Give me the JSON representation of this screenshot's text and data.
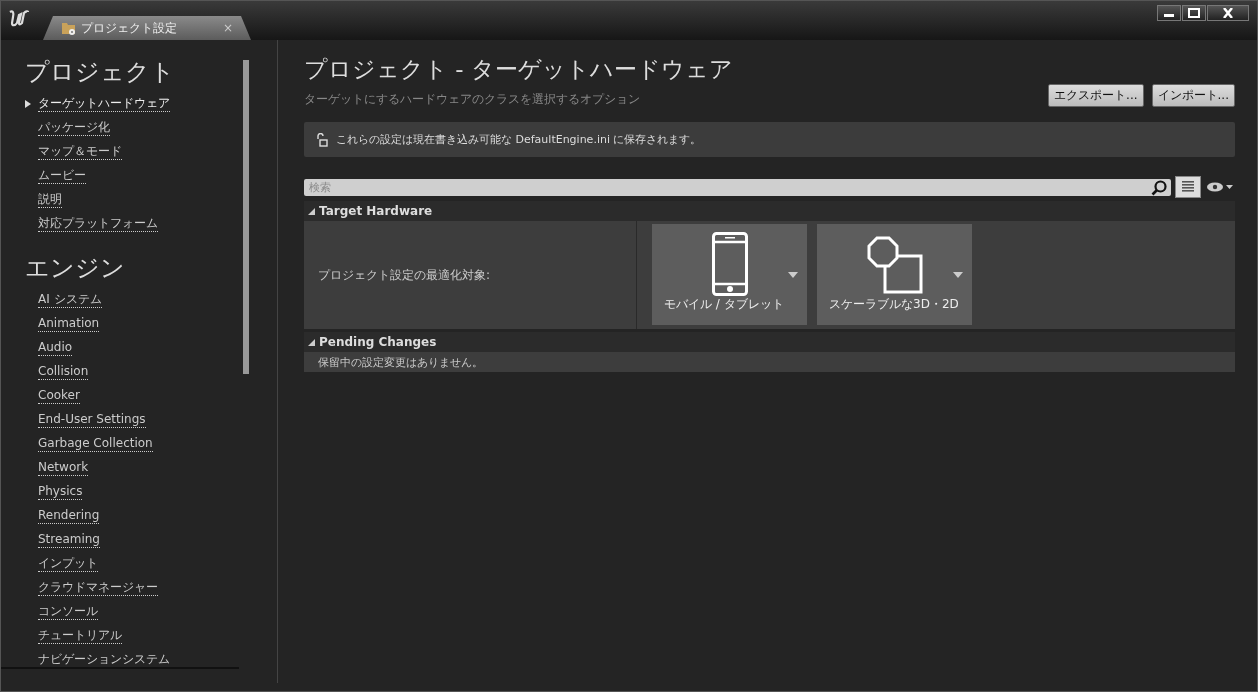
{
  "window": {
    "tab_title": "プロジェクト設定",
    "tab_close": "×"
  },
  "sidebar": {
    "sections": [
      {
        "title": "プロジェクト",
        "items": [
          {
            "label": "ターゲットハードウェア",
            "selected": true
          },
          {
            "label": "パッケージ化",
            "selected": false
          },
          {
            "label": "マップ＆モード",
            "selected": false
          },
          {
            "label": "ムービー",
            "selected": false
          },
          {
            "label": "説明",
            "selected": false
          },
          {
            "label": "対応プラットフォーム",
            "selected": false
          }
        ]
      },
      {
        "title": "エンジン",
        "items": [
          {
            "label": "AI システム",
            "selected": false
          },
          {
            "label": "Animation",
            "selected": false
          },
          {
            "label": "Audio",
            "selected": false
          },
          {
            "label": "Collision",
            "selected": false
          },
          {
            "label": "Cooker",
            "selected": false
          },
          {
            "label": "End-User Settings",
            "selected": false
          },
          {
            "label": "Garbage Collection",
            "selected": false
          },
          {
            "label": "Network",
            "selected": false
          },
          {
            "label": "Physics",
            "selected": false
          },
          {
            "label": "Rendering",
            "selected": false
          },
          {
            "label": "Streaming",
            "selected": false
          },
          {
            "label": "インプット",
            "selected": false
          },
          {
            "label": "クラウドマネージャー",
            "selected": false
          },
          {
            "label": "コンソール",
            "selected": false
          },
          {
            "label": "チュートリアル",
            "selected": false
          },
          {
            "label": "ナビゲーションシステム",
            "selected": false
          }
        ]
      }
    ]
  },
  "page": {
    "title": "プロジェクト - ターゲットハードウェア",
    "subtitle": "ターゲットにするハードウェアのクラスを選択するオプション",
    "buttons": [
      "エクスポート...",
      "インポート..."
    ],
    "notice": "これらの設定は現在書き込み可能な DefaultEngine.ini に保存されます。",
    "search": {
      "placeholder": "検索"
    }
  },
  "categories": [
    {
      "kind": "hardware",
      "title": "Target Hardware",
      "expanded": true,
      "label": "プロジェクト設定の最適化対象:",
      "options": [
        {
          "kind": "phone",
          "label": "モバイル / タブレット"
        },
        {
          "kind": "shapes",
          "label": "スケーラブルな3D・2D"
        }
      ]
    },
    {
      "kind": "message",
      "title": "Pending Changes",
      "expanded": true,
      "text": "保留中の設定変更はありません。"
    }
  ]
}
